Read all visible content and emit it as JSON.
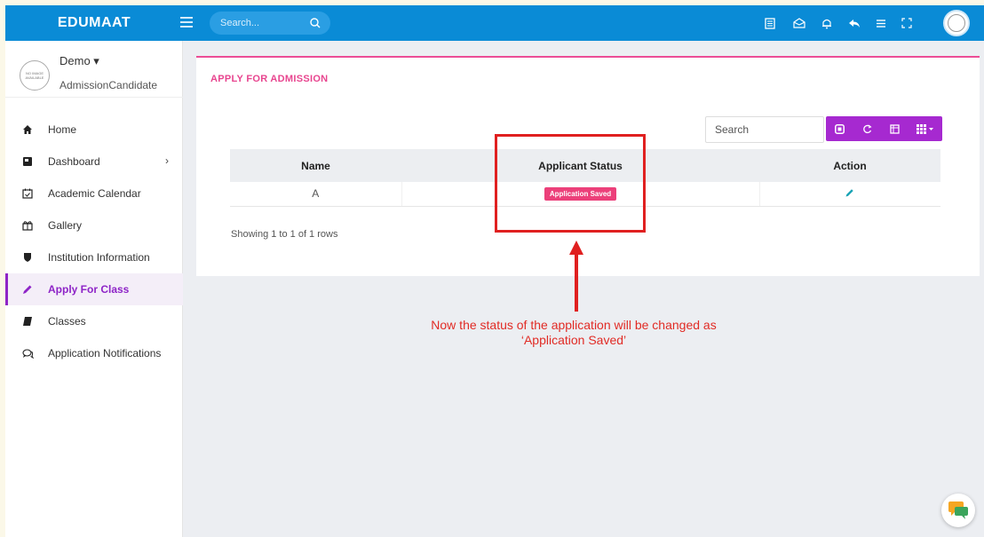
{
  "app": {
    "brand": "EDUMAAT"
  },
  "header": {
    "search_placeholder": "Search...",
    "icons": [
      "news-icon",
      "mail-icon",
      "bell-icon",
      "reply-icon",
      "list-icon",
      "fullscreen-icon"
    ],
    "accent_color": "#0a8bd6"
  },
  "profile": {
    "avatar_text": "NO IMAGE AVAILABLE",
    "name": "Demo ▾",
    "role": "AdmissionCandidate"
  },
  "sidebar": {
    "items": [
      {
        "label": "Home",
        "icon": "home-icon"
      },
      {
        "label": "Dashboard",
        "icon": "dashboard-icon",
        "chevron": "›"
      },
      {
        "label": "Academic Calendar",
        "icon": "calendar-icon"
      },
      {
        "label": "Gallery",
        "icon": "gallery-icon"
      },
      {
        "label": "Institution Information",
        "icon": "shield-icon"
      },
      {
        "label": "Apply For Class",
        "icon": "pencil-icon",
        "active": true
      },
      {
        "label": "Classes",
        "icon": "book-icon"
      },
      {
        "label": "Application Notifications",
        "icon": "chat-icon"
      }
    ]
  },
  "main": {
    "title": "APPLY FOR ADMISSION",
    "title_color": "#e8458f",
    "search_placeholder": "Search",
    "toolbar_color": "#a629d0",
    "table": {
      "headers": [
        "Name",
        "Applicant Status",
        "Action"
      ],
      "rows": [
        {
          "name": "A",
          "status": "Application Saved"
        }
      ]
    },
    "pagination": "Showing 1 to 1 of 1 rows"
  },
  "annotation": {
    "line1": "Now the status of the application will be changed as",
    "line2": "‘Application Saved’",
    "color": "#e02020"
  }
}
